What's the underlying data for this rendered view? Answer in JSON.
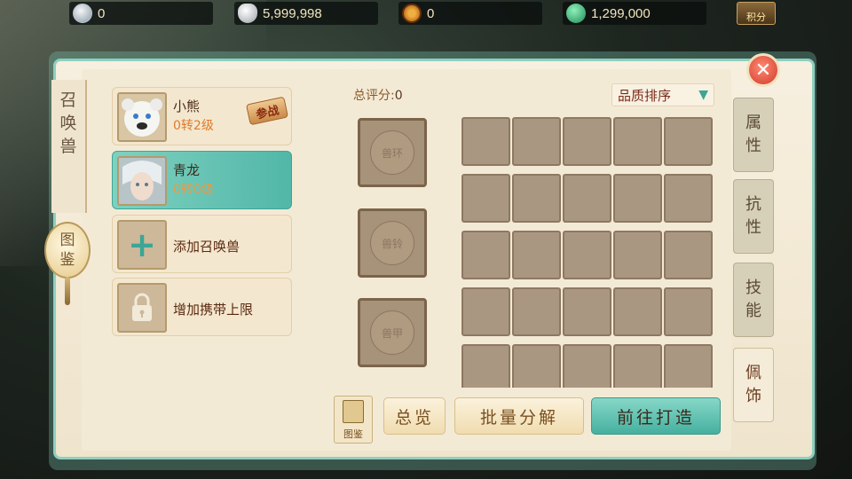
{
  "currencies": [
    {
      "icon": "silver-coin-icon",
      "value": "0"
    },
    {
      "icon": "silver-ingot-icon",
      "value": "5,999,998"
    },
    {
      "icon": "copper-coin-icon",
      "value": "0"
    },
    {
      "icon": "jade-icon",
      "value": "1,299,000"
    }
  ],
  "score_badge": "积分",
  "panel": {
    "title_chars": [
      "召",
      "唤",
      "兽"
    ],
    "tujian_chars": [
      "图",
      "鉴"
    ]
  },
  "pets": [
    {
      "name": "小熊",
      "level": "0转2级",
      "badge": "参战"
    },
    {
      "name": "青龙",
      "level": "0转0级"
    }
  ],
  "actions": {
    "add_pet": "添加召唤兽",
    "increase_limit": "增加携带上限"
  },
  "equipment": {
    "score_label": "总评分:",
    "score_value": "0",
    "sort_label": "品质排序",
    "slots": [
      "兽环",
      "兽铃",
      "兽甲"
    ]
  },
  "buttons": {
    "tujian": "图鉴",
    "overview": "总览",
    "batch_decompose": "批量分解",
    "go_forge": "前往打造"
  },
  "side_tabs": [
    {
      "chars": [
        "属",
        "性"
      ]
    },
    {
      "chars": [
        "抗",
        "性"
      ]
    },
    {
      "chars": [
        "技",
        "能"
      ]
    },
    {
      "chars": [
        "佩",
        "饰"
      ],
      "active": true
    }
  ],
  "close_symbol": "✕"
}
